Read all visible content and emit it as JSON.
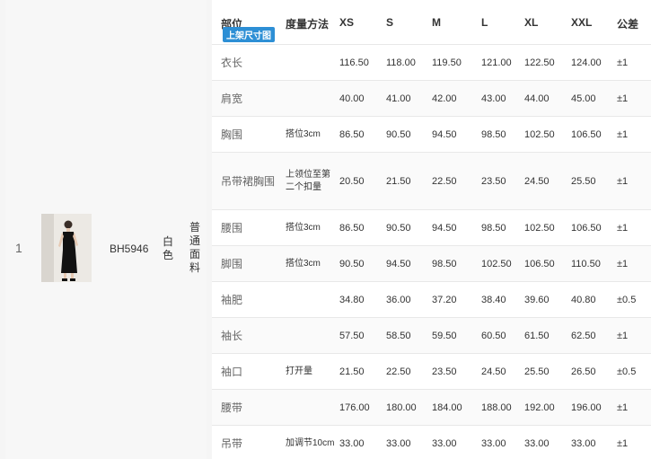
{
  "product": {
    "index": "1",
    "sku": "BH5946",
    "color": "白色",
    "fabric": "普通面料"
  },
  "table": {
    "headers": {
      "part": "部位",
      "method": "度量方法",
      "sizes": [
        "XS",
        "S",
        "M",
        "L",
        "XL",
        "XXL"
      ],
      "tolerance": "公差"
    },
    "badge": "上架尺寸图",
    "rows": [
      {
        "part": "衣长",
        "method": "",
        "values": [
          "116.50",
          "118.00",
          "119.50",
          "121.00",
          "122.50",
          "124.00"
        ],
        "tol": "±1"
      },
      {
        "part": "肩宽",
        "method": "",
        "values": [
          "40.00",
          "41.00",
          "42.00",
          "43.00",
          "44.00",
          "45.00"
        ],
        "tol": "±1"
      },
      {
        "part": "胸围",
        "method": "搭位3cm",
        "values": [
          "86.50",
          "90.50",
          "94.50",
          "98.50",
          "102.50",
          "106.50"
        ],
        "tol": "±1"
      },
      {
        "part": "吊带裙胸围",
        "method": "上领位至第二个扣量",
        "values": [
          "20.50",
          "21.50",
          "22.50",
          "23.50",
          "24.50",
          "25.50"
        ],
        "tol": "±1"
      },
      {
        "part": "腰围",
        "method": "搭位3cm",
        "values": [
          "86.50",
          "90.50",
          "94.50",
          "98.50",
          "102.50",
          "106.50"
        ],
        "tol": "±1"
      },
      {
        "part": "脚围",
        "method": "搭位3cm",
        "values": [
          "90.50",
          "94.50",
          "98.50",
          "102.50",
          "106.50",
          "110.50"
        ],
        "tol": "±1"
      },
      {
        "part": "袖肥",
        "method": "",
        "values": [
          "34.80",
          "36.00",
          "37.20",
          "38.40",
          "39.60",
          "40.80"
        ],
        "tol": "±0.5"
      },
      {
        "part": "袖长",
        "method": "",
        "values": [
          "57.50",
          "58.50",
          "59.50",
          "60.50",
          "61.50",
          "62.50"
        ],
        "tol": "±1"
      },
      {
        "part": "袖口",
        "method": "打开量",
        "values": [
          "21.50",
          "22.50",
          "23.50",
          "24.50",
          "25.50",
          "26.50"
        ],
        "tol": "±0.5"
      },
      {
        "part": "腰带",
        "method": "",
        "values": [
          "176.00",
          "180.00",
          "184.00",
          "188.00",
          "192.00",
          "196.00"
        ],
        "tol": "±1"
      },
      {
        "part": "吊带",
        "method": "加调节10cm",
        "values": [
          "33.00",
          "33.00",
          "33.00",
          "33.00",
          "33.00",
          "33.00"
        ],
        "tol": "±1"
      }
    ]
  }
}
